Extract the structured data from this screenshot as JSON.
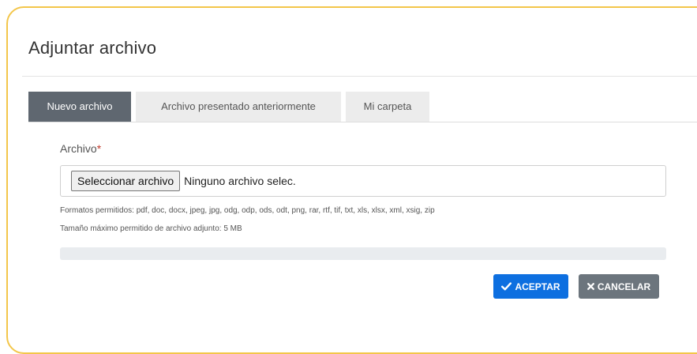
{
  "dialog": {
    "title": "Adjuntar archivo"
  },
  "tabs": [
    {
      "label": "Nuevo archivo",
      "active": true
    },
    {
      "label": "Archivo presentado anteriormente",
      "active": false
    },
    {
      "label": "Mi carpeta",
      "active": false
    }
  ],
  "form": {
    "field_label": "Archivo",
    "required_mark": "*",
    "file_button_label": "Seleccionar archivo",
    "file_status": "Ninguno archivo selec.",
    "formats_hint": "Formatos permitidos: pdf, doc, docx, jpeg, jpg, odg, odp, ods, odt, png, rar, rtf, tif, txt, xls, xlsx, xml, xsig, zip",
    "size_hint": "Tamaño máximo permitido de archivo adjunto: 5 MB",
    "upload_progress_percent": 0
  },
  "actions": {
    "accept_label": "ACEPTAR",
    "cancel_label": "CANCELAR"
  },
  "colors": {
    "frame_border": "#f3c64a",
    "active_tab": "#5f6770",
    "accept": "#0d6fe0",
    "cancel": "#6c757d",
    "required": "#c0392b"
  },
  "icons": {
    "accept": "check-icon",
    "cancel": "x-icon"
  }
}
